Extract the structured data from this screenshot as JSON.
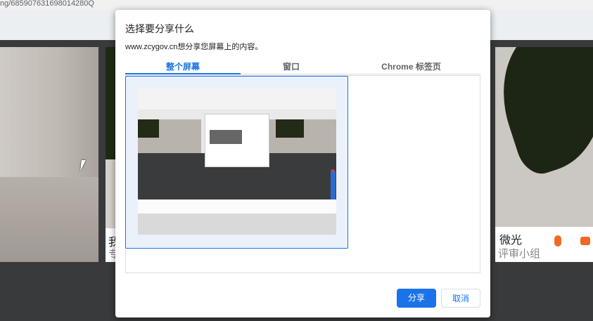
{
  "page": {
    "url_fragment": "ng/685907631698014280Q",
    "background_tiles": [
      {
        "caption_main": "",
        "caption_sub": ""
      },
      {
        "caption_main": "我",
        "caption_sub": "专"
      },
      {
        "name": "微光",
        "role": "评审小组"
      }
    ]
  },
  "dialog": {
    "title": "选择要分享什么",
    "subtitle": "www.zcygov.cn想分享您屏幕上的内容。",
    "tabs": [
      {
        "label": "整个屏幕",
        "selected": true
      },
      {
        "label": "窗口",
        "selected": false
      },
      {
        "label": "Chrome 标签页",
        "selected": false
      }
    ],
    "buttons": {
      "share": "分享",
      "cancel": "取消"
    }
  },
  "colors": {
    "accent": "#1a73e8",
    "mic": "#f06a25",
    "dark_bg": "#393a3c"
  },
  "icons": [
    "cursor-icon",
    "mic-icon",
    "camera-icon"
  ]
}
